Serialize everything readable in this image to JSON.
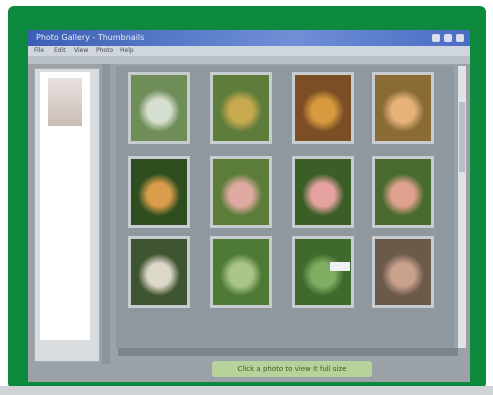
{
  "window": {
    "title": "Photo Gallery - Thumbnails"
  },
  "menu": {
    "items": [
      "File",
      "Edit",
      "View",
      "Photo",
      "Help"
    ]
  },
  "gallery": {
    "caption": "Click a photo to view it full size",
    "thumbnails": [
      {
        "name": "photo-01",
        "color": "#6f8d57",
        "accent": "#d6dfcf"
      },
      {
        "name": "photo-02",
        "color": "#5f7d3a",
        "accent": "#c9a94f"
      },
      {
        "name": "photo-03",
        "color": "#7b4e26",
        "accent": "#d79a3e"
      },
      {
        "name": "photo-04",
        "color": "#8a6b36",
        "accent": "#e7b27a"
      },
      {
        "name": "photo-05",
        "color": "#2f4e1f",
        "accent": "#d99d4b"
      },
      {
        "name": "photo-06",
        "color": "#5c7d39",
        "accent": "#e0a9a1"
      },
      {
        "name": "photo-07",
        "color": "#3b5e27",
        "accent": "#e6a2a0"
      },
      {
        "name": "photo-08",
        "color": "#4a6b2f",
        "accent": "#e0a18f"
      },
      {
        "name": "photo-09",
        "color": "#3f5530",
        "accent": "#ddd7c9"
      },
      {
        "name": "photo-10",
        "color": "#4f7a35",
        "accent": "#a9c58a"
      },
      {
        "name": "photo-11",
        "color": "#406a2d",
        "accent": "#7fae62"
      },
      {
        "name": "photo-12",
        "color": "#6b5a4a",
        "accent": "#c9a18d"
      }
    ]
  }
}
